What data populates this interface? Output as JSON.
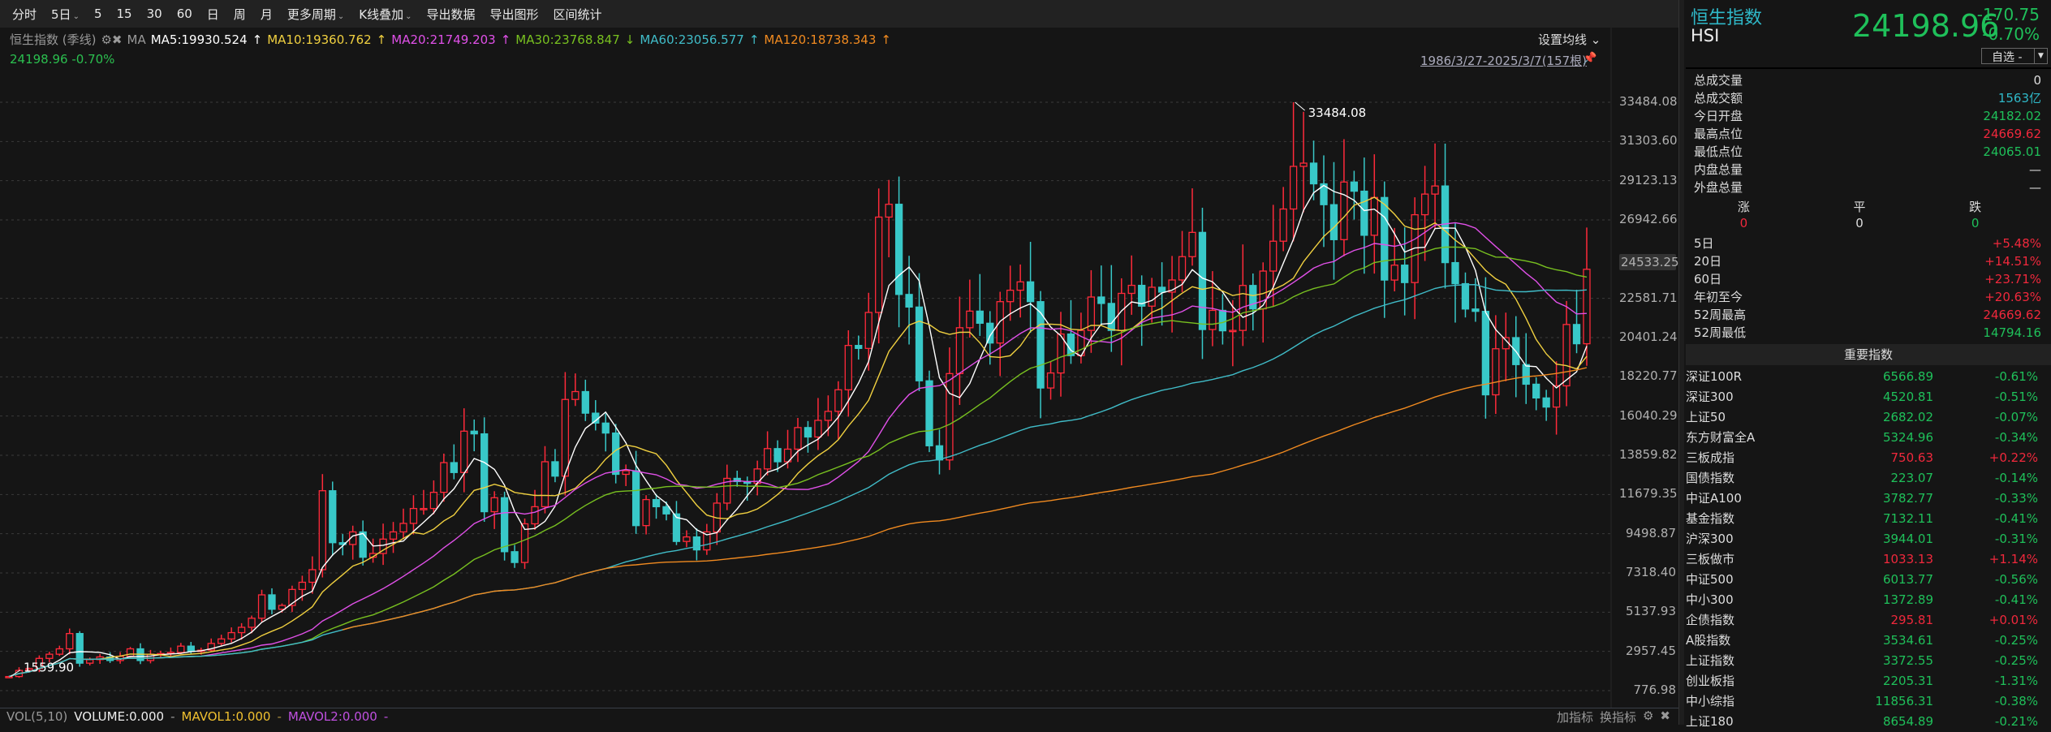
{
  "toolbar": {
    "items": [
      "分时",
      "5日",
      "5",
      "15",
      "30",
      "60",
      "日",
      "周",
      "月",
      "更多周期",
      "K线叠加",
      "导出数据",
      "导出图形",
      "区间统计"
    ],
    "brush_icon": "brush-icon",
    "fullscreen_icon": "fullscreen-icon"
  },
  "info": {
    "title": "恒生指数 (季线)",
    "ma_label": "MA",
    "ma": [
      {
        "label": "MA5:19930.524",
        "arrow": "↑",
        "color": "#ffffff"
      },
      {
        "label": "MA10:19360.762",
        "arrow": "↑",
        "color": "#f0d040"
      },
      {
        "label": "MA20:21749.203",
        "arrow": "↑",
        "color": "#e050e8"
      },
      {
        "label": "MA30:23768.847",
        "arrow": "↓",
        "color": "#78c020"
      },
      {
        "label": "MA60:23056.577",
        "arrow": "↑",
        "color": "#40bcc8"
      },
      {
        "label": "MA120:18738.343",
        "arrow": "↑",
        "color": "#f08a20"
      }
    ],
    "sub": "24198.96 -0.70%",
    "set_ma": "设置均线 ⌄",
    "range": "1986/3/27-2025/3/7(157根)"
  },
  "chart_data": {
    "type": "candlestick",
    "period": "quarterly",
    "x_range": [
      "1986/3/27",
      "2025/3/7"
    ],
    "ylim": [
      776.98,
      33484.08
    ],
    "yticks": [
      "33484.08",
      "31303.60",
      "29123.13",
      "26942.66",
      "22581.71",
      "20401.24",
      "18220.77",
      "16040.29",
      "13859.82",
      "11679.35",
      "9498.87",
      "7318.40",
      "5137.93",
      "2957.45",
      "776.98"
    ],
    "ytick_values": [
      33484.08,
      31303.6,
      29123.13,
      26942.66,
      22581.71,
      20401.24,
      18220.77,
      16040.29,
      13859.82,
      11679.35,
      9498.87,
      7318.4,
      5137.93,
      2957.45,
      776.98
    ],
    "highlight_label": "24533.25",
    "highlight_value": 24533.25,
    "annotations": {
      "max": "33484.08",
      "max_value": 33484.08,
      "max_index": 127,
      "min": "1559.90",
      "min_value": 1559.9,
      "min_index": 0
    },
    "ma_periods": [
      5,
      10,
      20,
      30,
      60,
      120
    ],
    "close": [
      1560,
      1900,
      2000,
      2568,
      2800,
      3100,
      3950,
      2303,
      2500,
      2650,
      2450,
      2687,
      3100,
      2450,
      2800,
      2837,
      2900,
      3250,
      2950,
      3025,
      3400,
      3650,
      4000,
      4297,
      4800,
      6100,
      5300,
      5512,
      6400,
      6800,
      7500,
      11888,
      9000,
      8900,
      9600,
      8191,
      8400,
      9200,
      9600,
      10073,
      10900,
      10900,
      11800,
      13451,
      12900,
      15200,
      15050,
      10723,
      11500,
      8500,
      7900,
      10049,
      11000,
      13500,
      12700,
      16962,
      17400,
      16200,
      15650,
      15096,
      12800,
      13000,
      9950,
      11397,
      11000,
      10600,
      9070,
      9321,
      8600,
      9600,
      11200,
      12576,
      12400,
      12300,
      13100,
      14230,
      13500,
      14200,
      15400,
      14876,
      15800,
      16300,
      17500,
      19965,
      19800,
      21800,
      27100,
      27813,
      22800,
      22100,
      18000,
      14387,
      13600,
      18400,
      20950,
      21873,
      21200,
      20100,
      22400,
      23035,
      23500,
      22400,
      17600,
      18434,
      20600,
      19400,
      20800,
      22657,
      22300,
      20800,
      22860,
      23306,
      22150,
      23200,
      22930,
      23605,
      24900,
      26250,
      20850,
      21914,
      20780,
      20800,
      23300,
      22000,
      24100,
      25760,
      27550,
      29919,
      30100,
      28950,
      27790,
      25846,
      29050,
      28540,
      26090,
      28190,
      23600,
      24430,
      23460,
      27231,
      28380,
      28830,
      24570,
      23398,
      21990,
      21860,
      17220,
      19781,
      20400,
      18900,
      17810,
      17047,
      16540,
      17720,
      21130,
      20060,
      24199
    ],
    "up_color": "#ff2a3a",
    "down_color": "#38c8c8"
  },
  "volume": {
    "name": "VOL(5,10)",
    "volume": "VOLUME:0.000",
    "mavol1": "MAVOL1:0.000",
    "mavol2": "MAVOL2:0.000",
    "dash": "-",
    "add": "加指标",
    "switch": "换指标"
  },
  "panel": {
    "name": "恒生指数",
    "code": "HSI",
    "price": "24198.96",
    "change": "-170.75",
    "change_pct": "-0.70%",
    "select": "自选 -",
    "stats": [
      {
        "label": "总成交量",
        "value": "0",
        "cls": "w"
      },
      {
        "label": "总成交额",
        "value": "1563亿",
        "cls": "c"
      },
      {
        "label": "今日开盘",
        "value": "24182.02",
        "cls": "g"
      },
      {
        "label": "最高点位",
        "value": "24669.62",
        "cls": "r"
      },
      {
        "label": "最低点位",
        "value": "24065.01",
        "cls": "g"
      },
      {
        "label": "内盘总量",
        "value": "—",
        "cls": "w"
      },
      {
        "label": "外盘总量",
        "value": "—",
        "cls": "w"
      }
    ],
    "breadth": {
      "up_label": "涨",
      "flat_label": "平",
      "down_label": "跌",
      "up": "0",
      "flat": "0",
      "down": "0"
    },
    "perf": [
      {
        "label": "5日",
        "value": "+5.48%",
        "cls": "r"
      },
      {
        "label": "20日",
        "value": "+14.51%",
        "cls": "r"
      },
      {
        "label": "60日",
        "value": "+23.71%",
        "cls": "r"
      },
      {
        "label": "年初至今",
        "value": "+20.63%",
        "cls": "r"
      },
      {
        "label": "52周最高",
        "value": "24669.62",
        "cls": "r"
      },
      {
        "label": "52周最低",
        "value": "14794.16",
        "cls": "g"
      }
    ],
    "indices_title": "重要指数",
    "indices": [
      {
        "name": "深证100R",
        "value": "6566.89",
        "pct": "-0.61%",
        "cls": "g"
      },
      {
        "name": "深证300",
        "value": "4520.81",
        "pct": "-0.51%",
        "cls": "g"
      },
      {
        "name": "上证50",
        "value": "2682.02",
        "pct": "-0.07%",
        "cls": "g"
      },
      {
        "name": "东方财富全A",
        "value": "5324.96",
        "pct": "-0.34%",
        "cls": "g"
      },
      {
        "name": "三板成指",
        "value": "750.63",
        "pct": "+0.22%",
        "cls": "r"
      },
      {
        "name": "国债指数",
        "value": "223.07",
        "pct": "-0.14%",
        "cls": "g"
      },
      {
        "name": "中证A100",
        "value": "3782.77",
        "pct": "-0.33%",
        "cls": "g"
      },
      {
        "name": "基金指数",
        "value": "7132.11",
        "pct": "-0.41%",
        "cls": "g"
      },
      {
        "name": "沪深300",
        "value": "3944.01",
        "pct": "-0.31%",
        "cls": "g"
      },
      {
        "name": "三板做市",
        "value": "1033.13",
        "pct": "+1.14%",
        "cls": "r"
      },
      {
        "name": "中证500",
        "value": "6013.77",
        "pct": "-0.56%",
        "cls": "g"
      },
      {
        "name": "中小300",
        "value": "1372.89",
        "pct": "-0.41%",
        "cls": "g"
      },
      {
        "name": "企债指数",
        "value": "295.81",
        "pct": "+0.01%",
        "cls": "r"
      },
      {
        "name": "A股指数",
        "value": "3534.61",
        "pct": "-0.25%",
        "cls": "g"
      },
      {
        "name": "上证指数",
        "value": "3372.55",
        "pct": "-0.25%",
        "cls": "g"
      },
      {
        "name": "创业板指",
        "value": "2205.31",
        "pct": "-1.31%",
        "cls": "g"
      },
      {
        "name": "中小综指",
        "value": "11856.31",
        "pct": "-0.38%",
        "cls": "g"
      },
      {
        "name": "上证180",
        "value": "8654.89",
        "pct": "-0.21%",
        "cls": "g"
      }
    ]
  }
}
